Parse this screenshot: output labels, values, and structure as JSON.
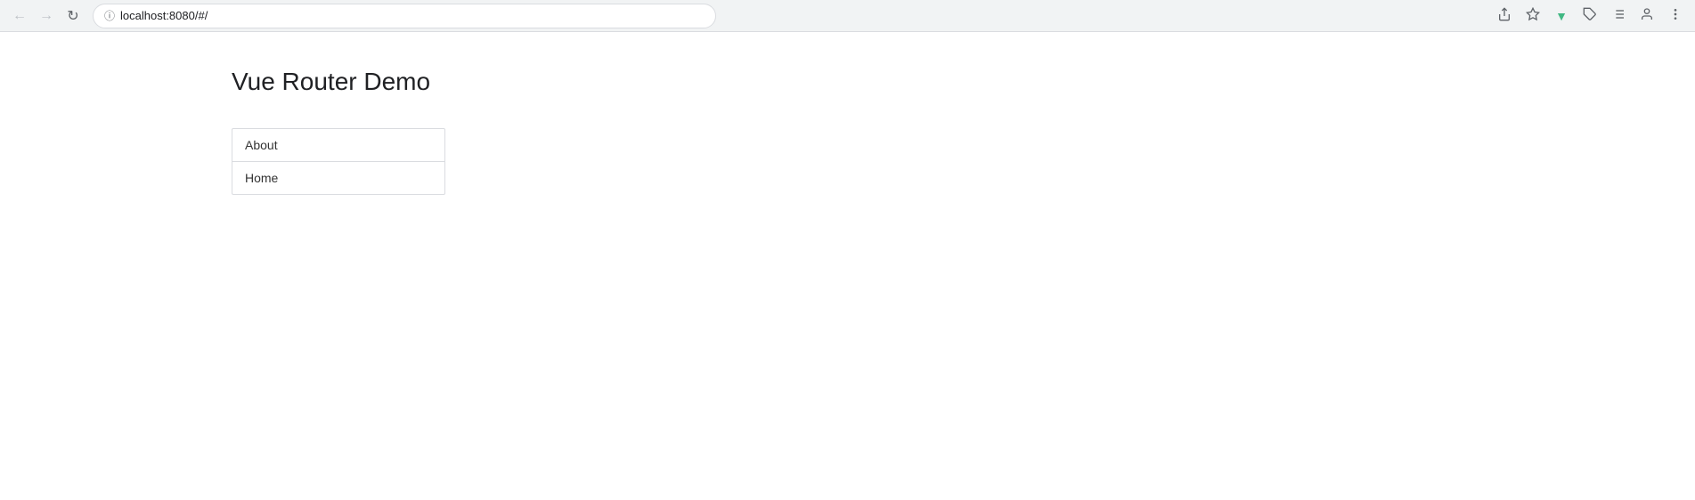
{
  "browser": {
    "url": "localhost:8080/#/",
    "nav": {
      "back_label": "←",
      "forward_label": "→",
      "reload_label": "↻"
    },
    "toolbar": {
      "share_icon": "share-icon",
      "bookmark_icon": "star-icon",
      "vue_icon": "vue-icon",
      "extensions_icon": "puzzle-icon",
      "readinglist_icon": "readinglist-icon",
      "account_icon": "account-icon",
      "menu_icon": "menu-icon"
    }
  },
  "page": {
    "title": "Vue Router Demo",
    "nav_items": [
      {
        "label": "About",
        "href": "#/about"
      },
      {
        "label": "Home",
        "href": "#/"
      }
    ]
  }
}
